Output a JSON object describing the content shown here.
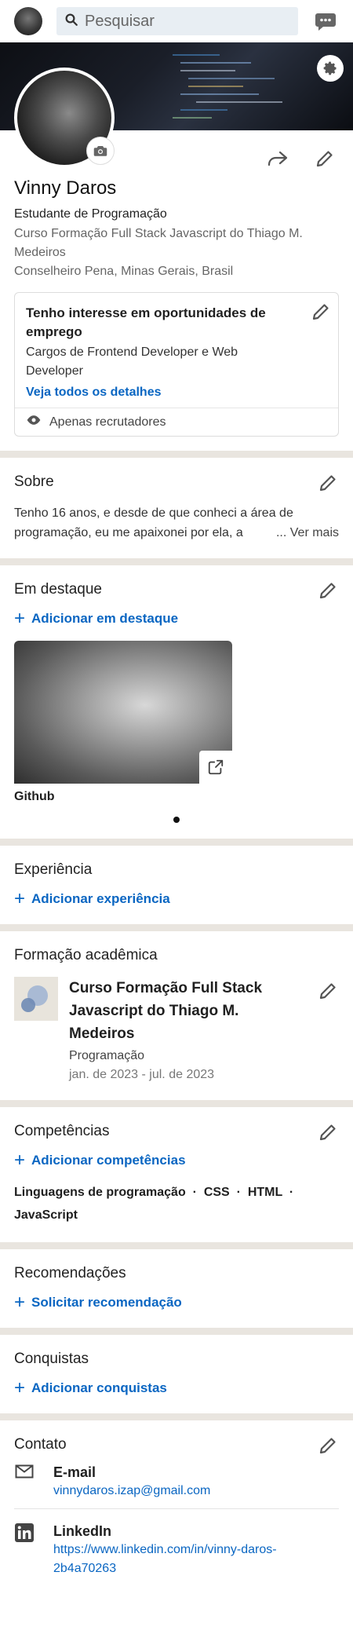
{
  "topbar": {
    "search_placeholder": "Pesquisar"
  },
  "intro": {
    "name": "Vinny Daros",
    "headline": "Estudante de Programação",
    "education": "Curso Formação Full Stack Javascript do Thiago M. Medeiros",
    "location": "Conselheiro Pena, Minas Gerais, Brasil"
  },
  "open_to_work": {
    "title": "Tenho interesse em oportunidades de emprego",
    "roles": "Cargos de Frontend Developer e Web Developer",
    "link": "Veja todos os detalhes",
    "visibility": "Apenas recrutadores"
  },
  "about": {
    "title": "Sobre",
    "text": "Tenho 16 anos, e desde de que conheci a área de programação, eu me apaixonei por ela, a",
    "more": "... Ver mais"
  },
  "featured": {
    "title": "Em destaque",
    "add_label": "Adicionar em destaque",
    "items": [
      {
        "title": "Github"
      }
    ]
  },
  "experience": {
    "title": "Experiência",
    "add_label": "Adicionar experiência"
  },
  "education": {
    "title": "Formação acadêmica",
    "items": [
      {
        "school": "Curso Formação Full Stack Javascript do Thiago M. Medeiros",
        "degree": "Programação",
        "dates": "jan. de 2023 - jul. de 2023"
      }
    ]
  },
  "skills": {
    "title": "Competências",
    "add_label": "Adicionar competências",
    "list": "Linguagens de programação  ·  CSS  ·  HTML  ·  JavaScript"
  },
  "recommendations": {
    "title": "Recomendações",
    "add_label": "Solicitar recomendação"
  },
  "accomplishments": {
    "title": "Conquistas",
    "add_label": "Adicionar conquistas"
  },
  "contact": {
    "title": "Contato",
    "items": [
      {
        "label": "E-mail",
        "value": "vinnydaros.izap@gmail.com",
        "icon": "envelope-icon"
      },
      {
        "label": "LinkedIn",
        "value": "https://www.linkedin.com/in/vinny-daros-2b4a70263",
        "icon": "linkedin-icon"
      }
    ]
  },
  "colors": {
    "link_blue": "#0a66c2",
    "section_separator": "#e9e5df"
  }
}
